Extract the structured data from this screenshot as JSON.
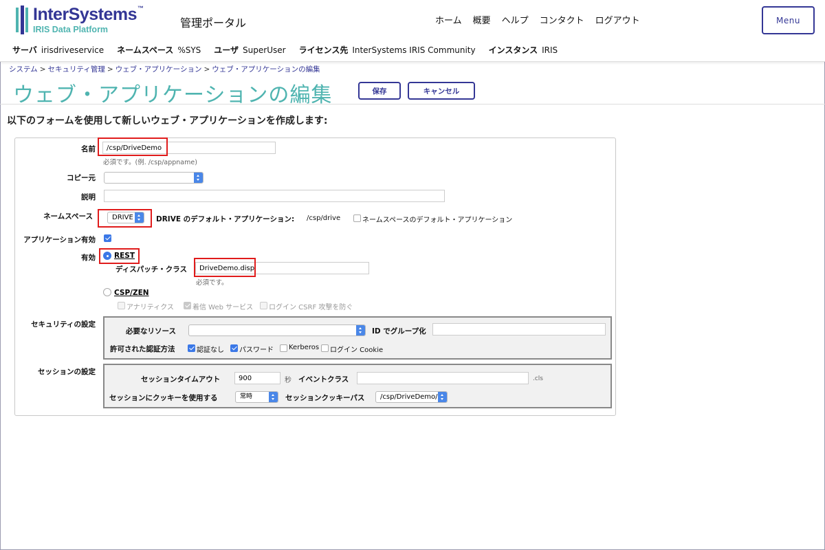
{
  "header": {
    "logo_name": "InterSystems",
    "logo_tm": "™",
    "logo_sub": "IRIS Data Platform",
    "portal_title": "管理ポータル",
    "nav": [
      "ホーム",
      "概要",
      "ヘルプ",
      "コンタクト",
      "ログアウト"
    ],
    "menu_label": "Menu",
    "info": [
      {
        "label": "サーバ",
        "value": "irisdriveservice"
      },
      {
        "label": "ネームスペース",
        "value": "%SYS"
      },
      {
        "label": "ユーザ",
        "value": "SuperUser"
      },
      {
        "label": "ライセンス先",
        "value": "InterSystems IRIS Community"
      },
      {
        "label": "インスタンス",
        "value": "IRIS"
      }
    ],
    "brand_color": "#333695",
    "accent_color": "#4fb4b0"
  },
  "breadcrumb": [
    "システム",
    "セキュリティ管理",
    "ウェブ・アプリケーション",
    "ウェブ・アプリケーションの編集"
  ],
  "breadcrumb_sep": ">",
  "page": {
    "title": "ウェブ・アプリケーションの編集",
    "save_label": "保存",
    "cancel_label": "キャンセル",
    "intro": "以下のフォームを使用して新しいウェブ・アプリケーションを作成します:"
  },
  "form": {
    "name": {
      "label": "名前",
      "value": "/csp/DriveDemo",
      "hint": "必須です。(例. /csp/appname)"
    },
    "copy_from": {
      "label": "コピー元",
      "value": ""
    },
    "description": {
      "label": "説明",
      "value": ""
    },
    "namespace": {
      "label": "ネームスペース",
      "value": "DRIVE",
      "default_app_label": "DRIVE のデフォルト・アプリケーション:",
      "default_app_value": "/csp/drive",
      "default_checkbox_label": "ネームスペースのデフォルト・アプリケーション",
      "default_checked": false
    },
    "app_enabled": {
      "label": "アプリケーション有効",
      "checked": true
    },
    "enable": {
      "label": "有効",
      "rest_label": "REST",
      "rest_selected": true,
      "dispatch_label": "ディスパッチ・クラス",
      "dispatch_value": "DriveDemo.disp",
      "dispatch_hint": "必須です。",
      "cspzen_label": "CSP/ZEN",
      "cspzen_selected": false,
      "cspzen_options": [
        {
          "label": "アナリティクス",
          "checked": false
        },
        {
          "label": "着信 Web サービス",
          "checked": true
        },
        {
          "label": "ログイン CSRF 攻撃を防ぐ",
          "checked": false
        }
      ]
    },
    "security": {
      "label": "セキュリティの設定",
      "resource_label": "必要なリソース",
      "resource_value": "",
      "group_label": "ID でグループ化",
      "group_value": "",
      "auth_label": "許可された認証方法",
      "auth_options": [
        {
          "label": "認証なし",
          "checked": true
        },
        {
          "label": "パスワード",
          "checked": true
        },
        {
          "label": "Kerberos",
          "checked": false
        },
        {
          "label": "ログイン Cookie",
          "checked": false
        }
      ]
    },
    "session": {
      "label": "セッションの設定",
      "timeout_label": "セッションタイムアウト",
      "timeout_value": "900",
      "timeout_unit": "秒",
      "event_class_label": "イベントクラス",
      "event_class_value": "",
      "event_class_suffix": ".cls",
      "cookie_use_label": "セッションにクッキーを使用する",
      "cookie_use_value": "常時",
      "cookie_path_label": "セッションクッキーパス",
      "cookie_path_value": "/csp/DriveDemo/"
    }
  },
  "highlight_color": "#e01b1b"
}
